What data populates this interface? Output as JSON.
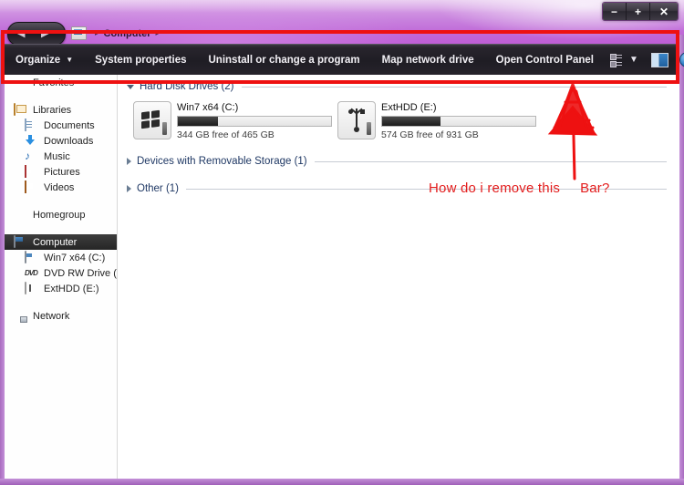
{
  "window": {
    "title_crumb": "Computer",
    "controls": {
      "minimize": "−",
      "maximize": "+",
      "close": "✕"
    },
    "nav": {
      "back": "◀",
      "forward": "▶"
    },
    "breadcrumb_sep": "▸",
    "trailing_sep": "▸"
  },
  "toolbar": {
    "organize": "Organize",
    "organize_caret": "▼",
    "system_properties": "System properties",
    "uninstall": "Uninstall or change a program",
    "map_network_drive": "Map network drive",
    "open_control_panel": "Open Control Panel",
    "view_caret": "▼",
    "help_glyph": "?"
  },
  "sidebar": {
    "favorites": "Favorites",
    "libraries": "Libraries",
    "documents": "Documents",
    "downloads": "Downloads",
    "music": "Music",
    "pictures": "Pictures",
    "videos": "Videos",
    "homegroup": "Homegroup",
    "computer": "Computer",
    "win7": "Win7 x64 (C:)",
    "dvd": "DVD RW Drive (D",
    "exthdd": "ExtHDD (E:)",
    "network": "Network",
    "dvd_glyph": "DVD"
  },
  "content": {
    "groups": [
      {
        "label": "Hard Disk Drives (2)",
        "expanded": true
      },
      {
        "label": "Devices with Removable Storage (1)",
        "expanded": false
      },
      {
        "label": "Other (1)",
        "expanded": false
      }
    ],
    "drives": [
      {
        "name": "Win7 x64 (C:)",
        "free_text": "344 GB free of 465 GB",
        "used_percent": 26,
        "icon": "windows-drive-icon"
      },
      {
        "name": "ExtHDD (E:)",
        "free_text": "574 GB free of 931 GB",
        "used_percent": 38,
        "icon": "usb-drive-icon"
      }
    ]
  },
  "annotation": {
    "question_part1": "How do i remove this",
    "question_part2": "Bar?",
    "color": "#e31d1d"
  }
}
